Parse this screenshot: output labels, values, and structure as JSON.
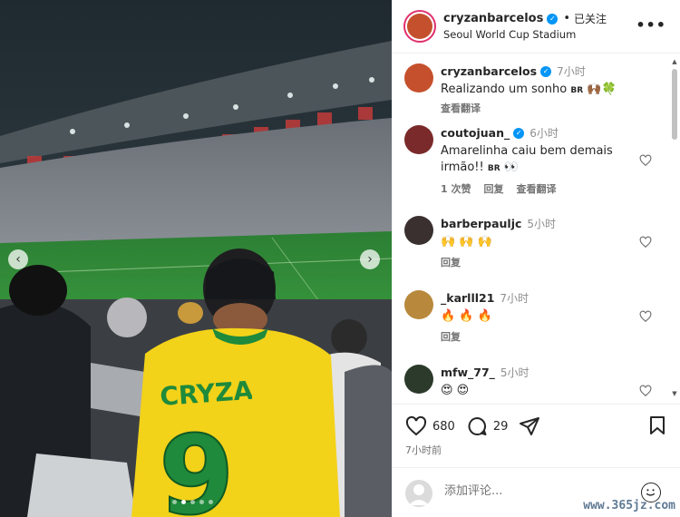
{
  "post": {
    "username": "cryzanbarcelos",
    "follow_sep": "•",
    "follow_label": "已关注",
    "location": "Seoul World Cup Stadium",
    "more_icon": "more-horizontal-icon"
  },
  "photo": {
    "jersey_name": "CRYZAN",
    "jersey_number": "9",
    "slide_count": 5,
    "active_slide": 1
  },
  "comments": [
    {
      "username": "cryzanbarcelos",
      "verified": true,
      "time": "7小时",
      "text": "Realizando um sonho",
      "flag": "BR",
      "emoji": "🙌🏾🍀",
      "actions": [
        "查看翻译"
      ]
    },
    {
      "username": "coutojuan_",
      "verified": true,
      "time": "6小时",
      "text_line1": "Amarelinha caiu bem demais",
      "text_line2": "irmão!!",
      "flag": "BR",
      "emoji": "👀",
      "actions": [
        "1 次赞",
        "回复",
        "查看翻译"
      ]
    },
    {
      "username": "barberpauljc",
      "verified": false,
      "time": "5小时",
      "text": "🙌 🙌 🙌",
      "actions": [
        "回复"
      ]
    },
    {
      "username": "_karlll21",
      "verified": false,
      "time": "7小时",
      "text": "🔥 🔥 🔥",
      "actions": [
        "回复"
      ]
    },
    {
      "username": "mfw_77_",
      "verified": false,
      "time": "5小时",
      "text": "😍 😍",
      "actions": []
    }
  ],
  "actions": {
    "likes": "680",
    "comments": "29",
    "posted": "7小时前"
  },
  "add_comment": {
    "placeholder": "添加评论..."
  },
  "watermark": "www.365jz.com",
  "colors": {
    "verified": "#0095f6",
    "jersey_yellow": "#f3d21a",
    "jersey_green": "#1f8a3b",
    "pitch": "#2f8a36"
  }
}
